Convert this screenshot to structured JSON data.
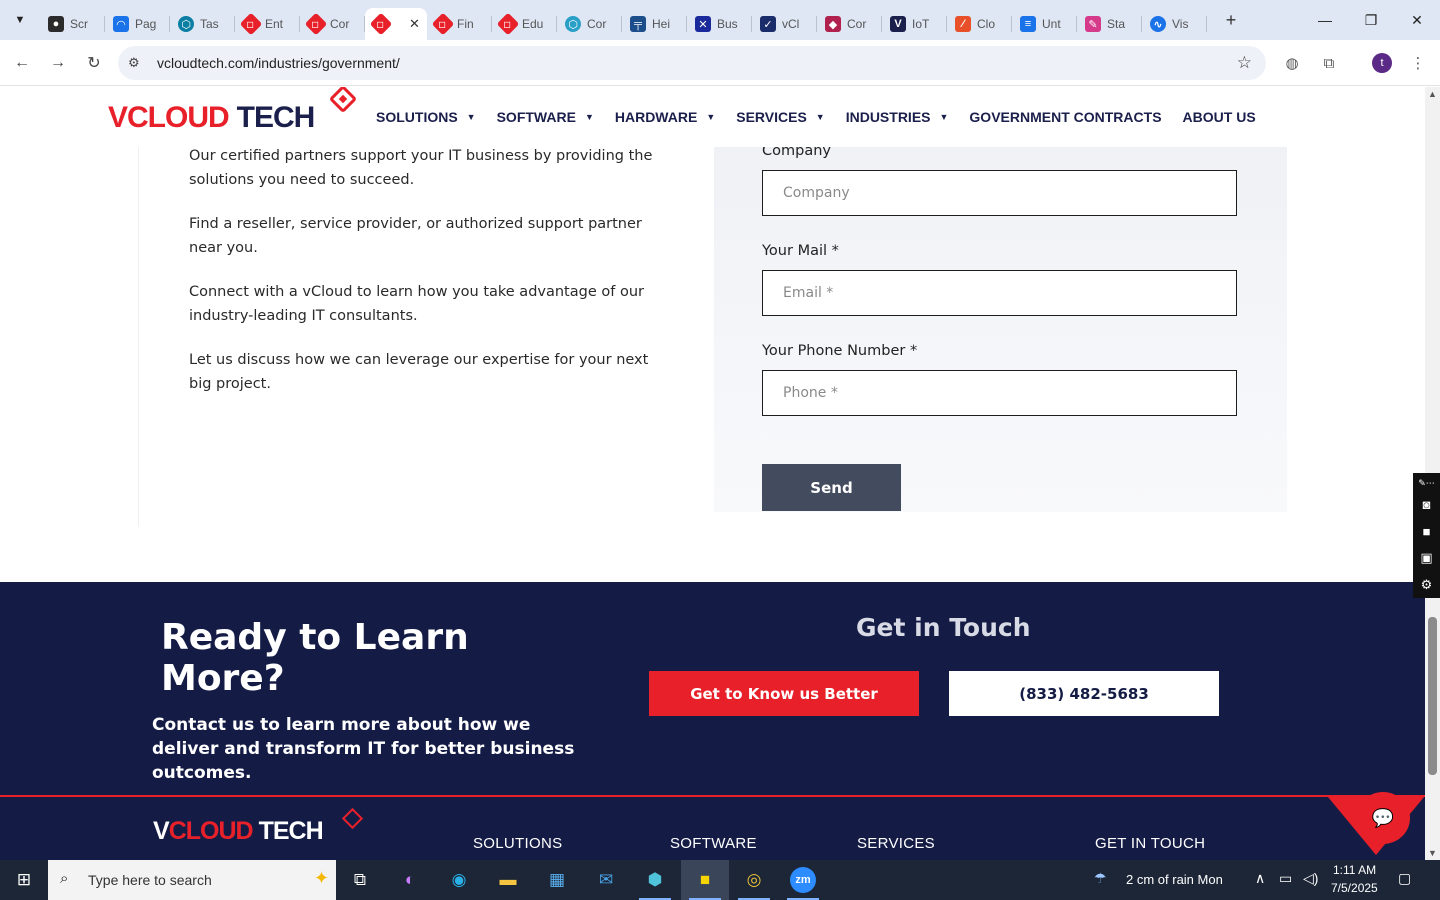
{
  "browser": {
    "tabs": [
      {
        "label": "Scr",
        "icon": "camera-icon",
        "color": "#2b2b2b"
      },
      {
        "label": "Pag",
        "icon": "gauge-icon",
        "color": "#1a73e8"
      },
      {
        "label": "Tas",
        "icon": "hexagon-icon",
        "color": "#0a7ea3"
      },
      {
        "label": "Ent",
        "icon": "vcloud-icon",
        "color": "#e8202a"
      },
      {
        "label": "Cor",
        "icon": "vcloud-icon",
        "color": "#e8202a"
      },
      {
        "label": "",
        "icon": "vcloud-icon",
        "color": "#e8202a",
        "active": true
      },
      {
        "label": "Fin",
        "icon": "vcloud-icon",
        "color": "#e8202a"
      },
      {
        "label": "Edu",
        "icon": "vcloud-icon",
        "color": "#e8202a"
      },
      {
        "label": "Cor",
        "icon": "hexagon-icon",
        "color": "#2aa0c8"
      },
      {
        "label": "Hei",
        "icon": "ruler-icon",
        "color": "#1b4e8a"
      },
      {
        "label": "Bus",
        "icon": "x-icon",
        "color": "#1a2a9c"
      },
      {
        "label": "vCl",
        "icon": "check-icon",
        "color": "#1b2c6b"
      },
      {
        "label": "Cor",
        "icon": "diamond-icon",
        "color": "#b0224d"
      },
      {
        "label": "IoT",
        "icon": "v-icon",
        "color": "#1b1f4b"
      },
      {
        "label": "Clo",
        "icon": "slash-icon",
        "color": "#e8502a"
      },
      {
        "label": "Unt",
        "icon": "doc-icon",
        "color": "#1a73e8"
      },
      {
        "label": "Sta",
        "icon": "pen-icon",
        "color": "#d63a8a"
      },
      {
        "label": "Vis",
        "icon": "pulse-icon",
        "color": "#1a73e8"
      }
    ],
    "url": "vcloudtech.com/industries/government/",
    "profile_initial": "t"
  },
  "header": {
    "logo": {
      "v": "V",
      "cloud": "CLOUD",
      "tech": "TECH"
    },
    "nav": [
      {
        "label": "SOLUTIONS",
        "dropdown": true
      },
      {
        "label": "SOFTWARE",
        "dropdown": true
      },
      {
        "label": "HARDWARE",
        "dropdown": true
      },
      {
        "label": "SERVICES",
        "dropdown": true
      },
      {
        "label": "INDUSTRIES",
        "dropdown": true
      },
      {
        "label": "GOVERNMENT CONTRACTS",
        "dropdown": false
      },
      {
        "label": "ABOUT US",
        "dropdown": false
      }
    ]
  },
  "content": {
    "paragraphs": [
      "Our certified partners support your IT business by providing the solutions you need to succeed.",
      "Find a reseller, service provider, or authorized support partner near you.",
      "Connect with a vCloud to learn how you take advantage of our industry-leading IT consultants.",
      "Let us discuss how we can leverage our expertise for your next big project."
    ]
  },
  "form": {
    "company_label": "Company",
    "company_placeholder": "Company",
    "mail_label": "Your Mail *",
    "mail_placeholder": "Email *",
    "phone_label": "Your Phone Number *",
    "phone_placeholder": "Phone *",
    "send_label": "Send"
  },
  "cta": {
    "title": "Ready to Learn More?",
    "subtitle": "Contact us to learn more about how we deliver and transform IT for better business outcomes.",
    "get_in_touch": "Get in Touch",
    "know_button": "Get to Know us Better",
    "phone_button": "(833) 482-5683"
  },
  "footer": {
    "logo": {
      "v": "V",
      "cloud": "CLOUD",
      "tech": "TECH"
    },
    "columns": [
      "SOLUTIONS",
      "SOFTWARE",
      "SERVICES",
      "GET IN TOUCH"
    ]
  },
  "taskbar": {
    "search_placeholder": "Type here to search",
    "weather": "2 cm of rain Mon",
    "time": "1:11 AM",
    "date": "7/5/2025"
  },
  "colors": {
    "brand_red": "#e8202a",
    "brand_navy": "#141c46",
    "send_button": "#434b5e"
  }
}
